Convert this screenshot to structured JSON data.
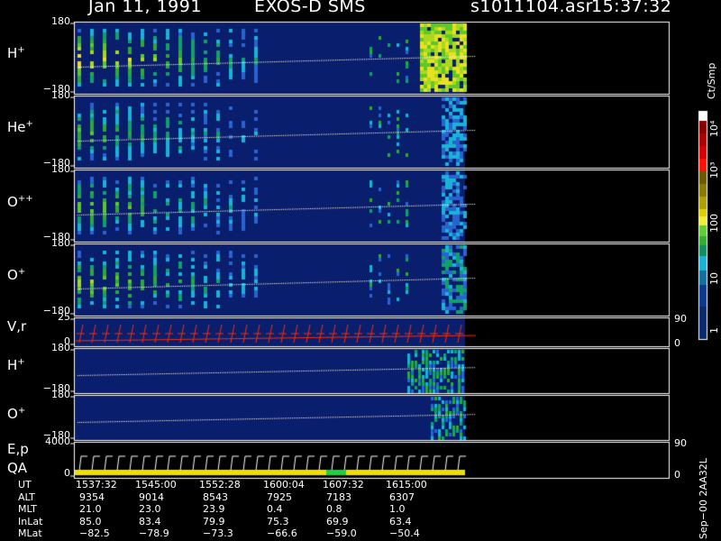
{
  "header": {
    "date": "Jan 11, 1991",
    "instrument": "EXOS-D SMS",
    "file": "s1011104.asr",
    "time": "15:37:32"
  },
  "panels": [
    {
      "id": "h-plus",
      "label": "H",
      "sup": "+",
      "ymax": "180",
      "ymin": "−180"
    },
    {
      "id": "he-plus",
      "label": "He",
      "sup": "+",
      "ymax": "180",
      "ymin": "−180"
    },
    {
      "id": "o-pp",
      "label": "O",
      "sup": "++",
      "ymax": "180",
      "ymin": "−180"
    },
    {
      "id": "o-plus",
      "label": "O",
      "sup": "+",
      "ymax": "180",
      "ymin": "−180"
    },
    {
      "id": "vr",
      "label": "V,r",
      "sup": "",
      "ymax": "25",
      "ymin": "0",
      "rmax": "90",
      "rmin": "0"
    },
    {
      "id": "h-plus-2",
      "label": "H",
      "sup": "+",
      "ymax": "180",
      "ymin": "−180"
    },
    {
      "id": "o-plus-2",
      "label": "O",
      "sup": "+",
      "ymax": "180",
      "ymin": "−180"
    },
    {
      "id": "ep",
      "label": "E,p",
      "sup": "",
      "ymax": "4000",
      "ymin": "0",
      "rmax": "90",
      "rmin": "0"
    }
  ],
  "qa_label": "QA",
  "colorbar": {
    "title": "Ct/Smp",
    "ticks": [
      "10⁴",
      "10³",
      "100",
      "10",
      "1"
    ]
  },
  "footer_code": "Sep−00  2AA32L",
  "orbit_table": {
    "rows": [
      {
        "label": "UT",
        "values": [
          "1537:32",
          "1545:00",
          "1552:28",
          "1600:04",
          "1607:32",
          "1615:00"
        ]
      },
      {
        "label": "ALT",
        "values": [
          "9354",
          "9014",
          "8543",
          "7925",
          "7183",
          "6307"
        ]
      },
      {
        "label": "MLT",
        "values": [
          "21.0",
          "23.0",
          "23.9",
          "0.4",
          "0.8",
          "1.0"
        ]
      },
      {
        "label": "InLat",
        "values": [
          "85.0",
          "83.4",
          "79.9",
          "75.3",
          "69.9",
          "63.4"
        ]
      },
      {
        "label": "MLat",
        "values": [
          "−82.5",
          "−78.9",
          "−73.3",
          "−66.6",
          "−59.0",
          "−50.4"
        ]
      }
    ]
  },
  "chart_data": {
    "type": "heatmap",
    "title": "Jan 11, 1991   EXOS-D SMS",
    "x_axis": {
      "label": "UT",
      "ticks": [
        "1537:32",
        "1545:00",
        "1552:28",
        "1600:04",
        "1607:32",
        "1615:00"
      ]
    },
    "color_scale": {
      "label": "Ct/Smp",
      "log": true,
      "range": [
        1,
        10000
      ]
    },
    "data_extent": {
      "from": "1537:32",
      "to": "1618:00"
    },
    "qa_flag_colors": {
      "good": "#f0e000",
      "flag": "#20d040"
    },
    "colors": {
      "background": "#0a1e6e",
      "trace": "#ffffff",
      "velocity": "#ff2a00"
    }
  }
}
